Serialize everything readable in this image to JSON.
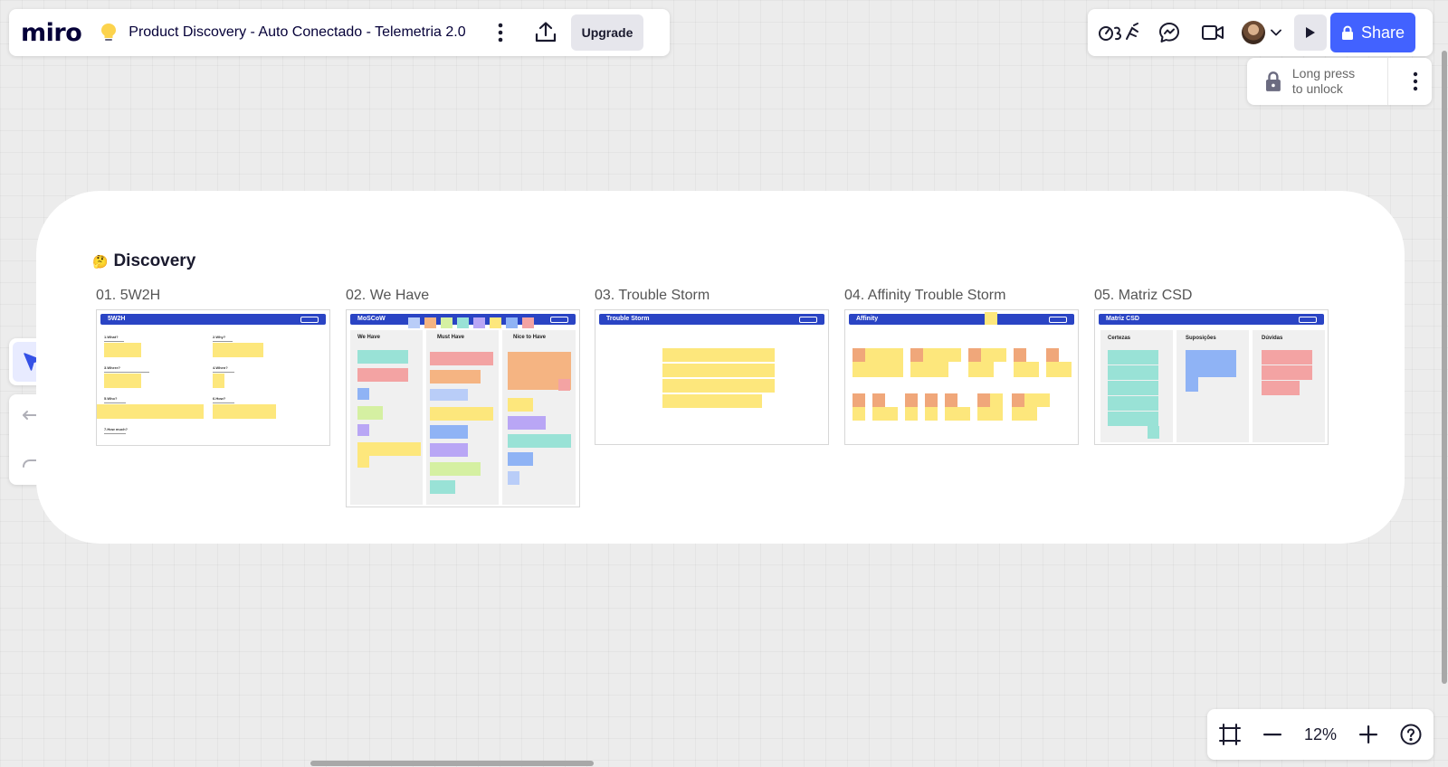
{
  "app": {
    "logo": "miro",
    "board_title": "Product Discovery - Auto Conectado - Telemetria 2.0",
    "upgrade_label": "Upgrade"
  },
  "header": {
    "share_label": "Share"
  },
  "lock": {
    "line1": "Long press",
    "line2": "to unlock"
  },
  "zoom": {
    "level": "12%"
  },
  "board": {
    "section_title": "Discovery",
    "section_emoji": "🤔",
    "frames": [
      {
        "label": "01. 5W2H",
        "header": "5W2H"
      },
      {
        "label": "02. We Have",
        "header": "MoSCoW",
        "columns": [
          "We Have",
          "Must Have",
          "Nice to Have"
        ]
      },
      {
        "label": "03. Trouble Storm",
        "header": "Trouble Storm"
      },
      {
        "label": "04. Affinity Trouble Storm",
        "header": "Affinity"
      },
      {
        "label": "05. Matriz CSD",
        "header": "Matriz CSD",
        "columns": [
          "Certezas",
          "Suposições",
          "Dúvidas"
        ]
      }
    ],
    "w2h_labels": [
      "1.What?",
      "2.Why?",
      "3.Where?",
      "4.When?",
      "5.Who?",
      "6.How?",
      "7.How much?"
    ]
  },
  "colors": {
    "brand_blue": "#4262ff",
    "frame_header": "#2a44c4",
    "sticky_yellow": "#fde77c"
  }
}
